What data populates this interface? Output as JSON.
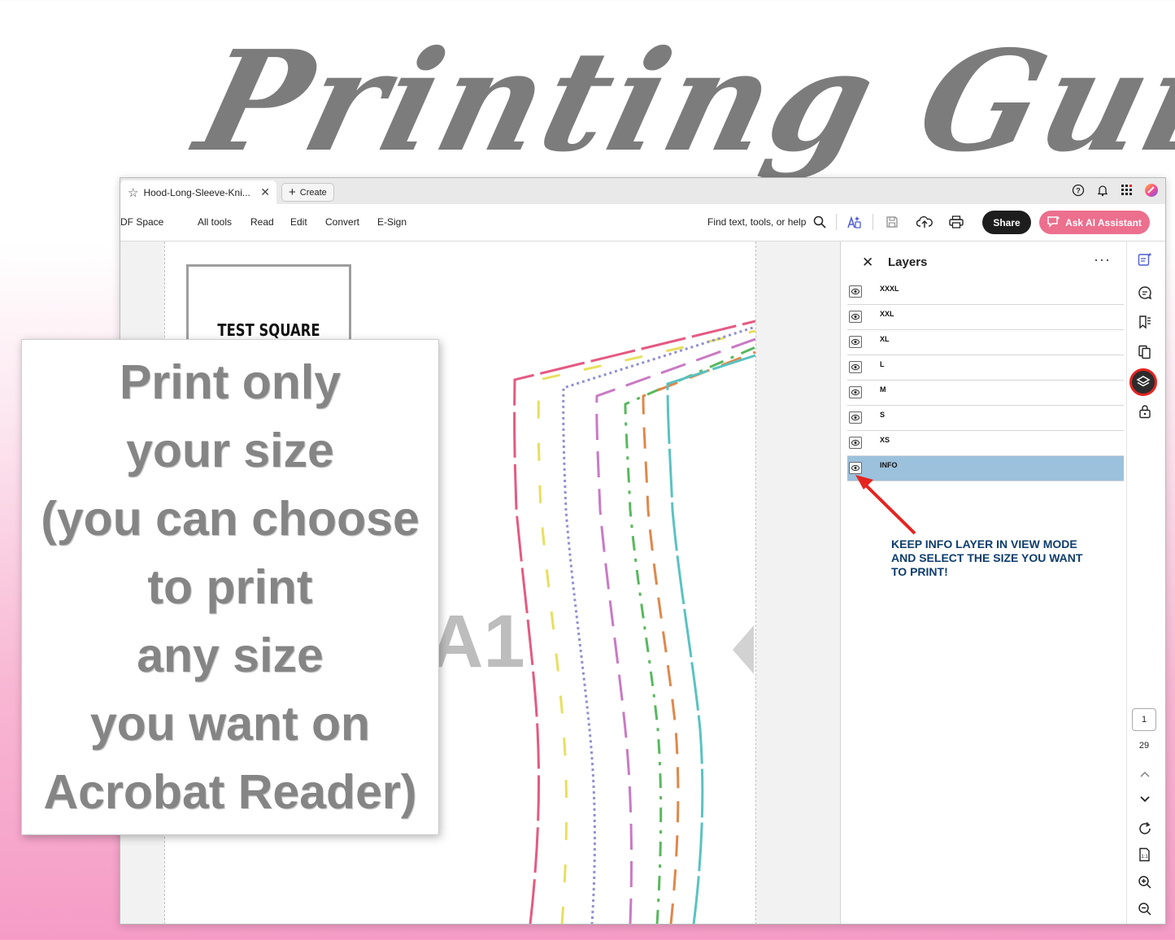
{
  "heading": {
    "text": "Printing Guide"
  },
  "window": {
    "tab": {
      "title": "Hood-Long-Sleeve-Kni...",
      "star_icon": "star-icon",
      "close_icon": "close-icon"
    },
    "create_button": "Create",
    "toolbar": {
      "menu": [
        "DF Space",
        "All tools",
        "Read",
        "Edit",
        "Convert",
        "E-Sign"
      ],
      "search_label": "Find text, tools, or help",
      "share_label": "Share",
      "ai_label": "Ask AI Assistant"
    },
    "document": {
      "test_square_label": "TEST SQUARE",
      "page_label": "A1",
      "pattern_colors": [
        "#e45a82",
        "#e8df5e",
        "#8f8fd0",
        "#c97ac4",
        "#58b85e",
        "#e0874a",
        "#5ac2c2"
      ]
    },
    "layers_panel": {
      "title": "Layers",
      "layers": [
        {
          "name": "XXXL",
          "selected": false
        },
        {
          "name": "XXL",
          "selected": false
        },
        {
          "name": "XL",
          "selected": false
        },
        {
          "name": "L",
          "selected": false
        },
        {
          "name": "M",
          "selected": false
        },
        {
          "name": "S",
          "selected": false
        },
        {
          "name": "XS",
          "selected": false
        },
        {
          "name": "INFO",
          "selected": true
        }
      ],
      "annotation": [
        "KEEP INFO LAYER IN VIEW MODE",
        "AND SELECT THE SIZE YOU WANT",
        "TO PRINT!"
      ]
    },
    "page_nav": {
      "current": "1",
      "total": "29"
    }
  },
  "note": {
    "lines": [
      "Print only",
      "your size",
      "(you can choose",
      "to print",
      "any size",
      "you want on",
      "Acrobat Reader)"
    ]
  },
  "colors": {
    "accent_red": "#e5241f",
    "ai_button": "#ec6f8e",
    "layer_selected": "#9cc1dc",
    "annotation_text": "#0e3d6e"
  }
}
